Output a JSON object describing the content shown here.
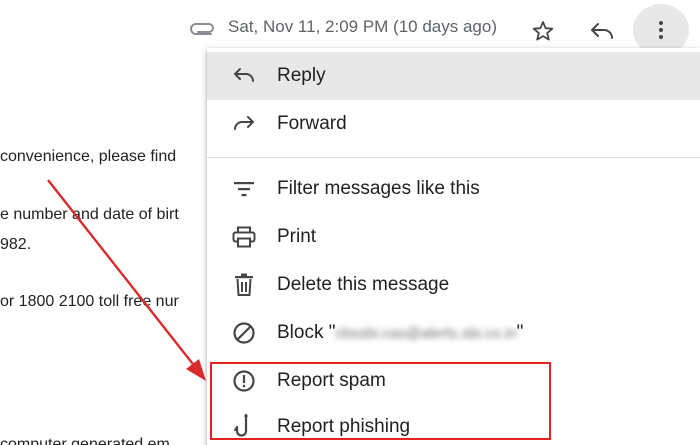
{
  "header": {
    "date": "Sat, Nov 11, 2:09 PM (10 days ago)"
  },
  "body_text": [
    "convenience, please find",
    "e number and date of birt",
    "982.",
    "or 1800 2100 toll free nur",
    "computer generated em"
  ],
  "menu": {
    "items": [
      {
        "label": "Reply",
        "icon": "reply-icon"
      },
      {
        "label": "Forward",
        "icon": "forward-icon"
      },
      {
        "label": "Filter messages like this",
        "icon": "filter-icon"
      },
      {
        "label": "Print",
        "icon": "print-icon"
      },
      {
        "label": "Delete this message",
        "icon": "trash-icon"
      },
      {
        "label_prefix": "Block \"",
        "label_blurred": "cbssbi.cas@alerts.sbi.co.in",
        "label_suffix": "\"",
        "icon": "block-icon"
      },
      {
        "label": "Report spam",
        "icon": "report-spam-icon"
      },
      {
        "label": "Report phishing",
        "icon": "phishing-hook-icon"
      }
    ]
  },
  "colors": {
    "highlight": "#e02424",
    "arrow": "#d92b2b",
    "hover_bg": "#e8e8e8",
    "icon": "#444746"
  }
}
